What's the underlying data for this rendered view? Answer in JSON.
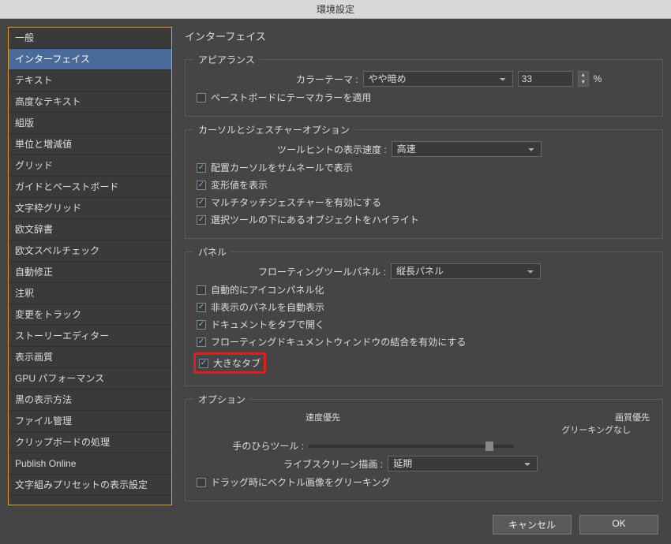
{
  "window": {
    "title": "環境設定"
  },
  "sidebar": {
    "items": [
      "一般",
      "インターフェイス",
      "テキスト",
      "高度なテキスト",
      "組版",
      "単位と増減値",
      "グリッド",
      "ガイドとペーストボード",
      "文字枠グリッド",
      "欧文辞書",
      "欧文スペルチェック",
      "自動修正",
      "注釈",
      "変更をトラック",
      "ストーリーエディター",
      "表示画質",
      "GPU パフォーマンス",
      "黒の表示方法",
      "ファイル管理",
      "クリップボードの処理",
      "Publish Online",
      "文字組みプリセットの表示設定"
    ],
    "selectedIndex": 1
  },
  "main": {
    "heading": "インターフェイス",
    "appearance": {
      "legend": "アピアランス",
      "colorThemeLabel": "カラーテーマ :",
      "colorThemeValue": "やや暗め",
      "percentValue": "33",
      "percentSuffix": "%",
      "applyPasteboard": {
        "label": "ペーストボードにテーマカラーを適用",
        "checked": false
      }
    },
    "cursor": {
      "legend": "カーソルとジェスチャーオプション",
      "tooltipSpeedLabel": "ツールヒントの表示速度 :",
      "tooltipSpeedValue": "高速",
      "placeCursor": {
        "label": "配置カーソルをサムネールで表示",
        "checked": true
      },
      "transforms": {
        "label": "変形値を表示",
        "checked": true
      },
      "multitouch": {
        "label": "マルチタッチジェスチャーを有効にする",
        "checked": true
      },
      "highlight": {
        "label": "選択ツールの下にあるオブジェクトをハイライト",
        "checked": true
      }
    },
    "panel": {
      "legend": "パネル",
      "floatingLabel": "フローティングツールパネル :",
      "floatingValue": "縦長パネル",
      "autoIcon": {
        "label": "自動的にアイコンパネル化",
        "checked": false
      },
      "autoShow": {
        "label": "非表示のパネルを自動表示",
        "checked": true
      },
      "openTab": {
        "label": "ドキュメントをタブで開く",
        "checked": true
      },
      "combine": {
        "label": "フローティングドキュメントウィンドウの結合を有効にする",
        "checked": true
      },
      "largeTab": {
        "label": "大きなタブ",
        "checked": true
      }
    },
    "options": {
      "legend": "オプション",
      "speedPriority": "速度優先",
      "qualityPriority": "画質優先",
      "greekingNone": "グリーキングなし",
      "handTool": "手のひらツール :",
      "liveScreenLabel": "ライブスクリーン描画 :",
      "liveScreenValue": "延期",
      "vectorGreek": {
        "label": "ドラッグ時にベクトル画像をグリーキング",
        "checked": false
      }
    }
  },
  "footer": {
    "cancel": "キャンセル",
    "ok": "OK"
  }
}
